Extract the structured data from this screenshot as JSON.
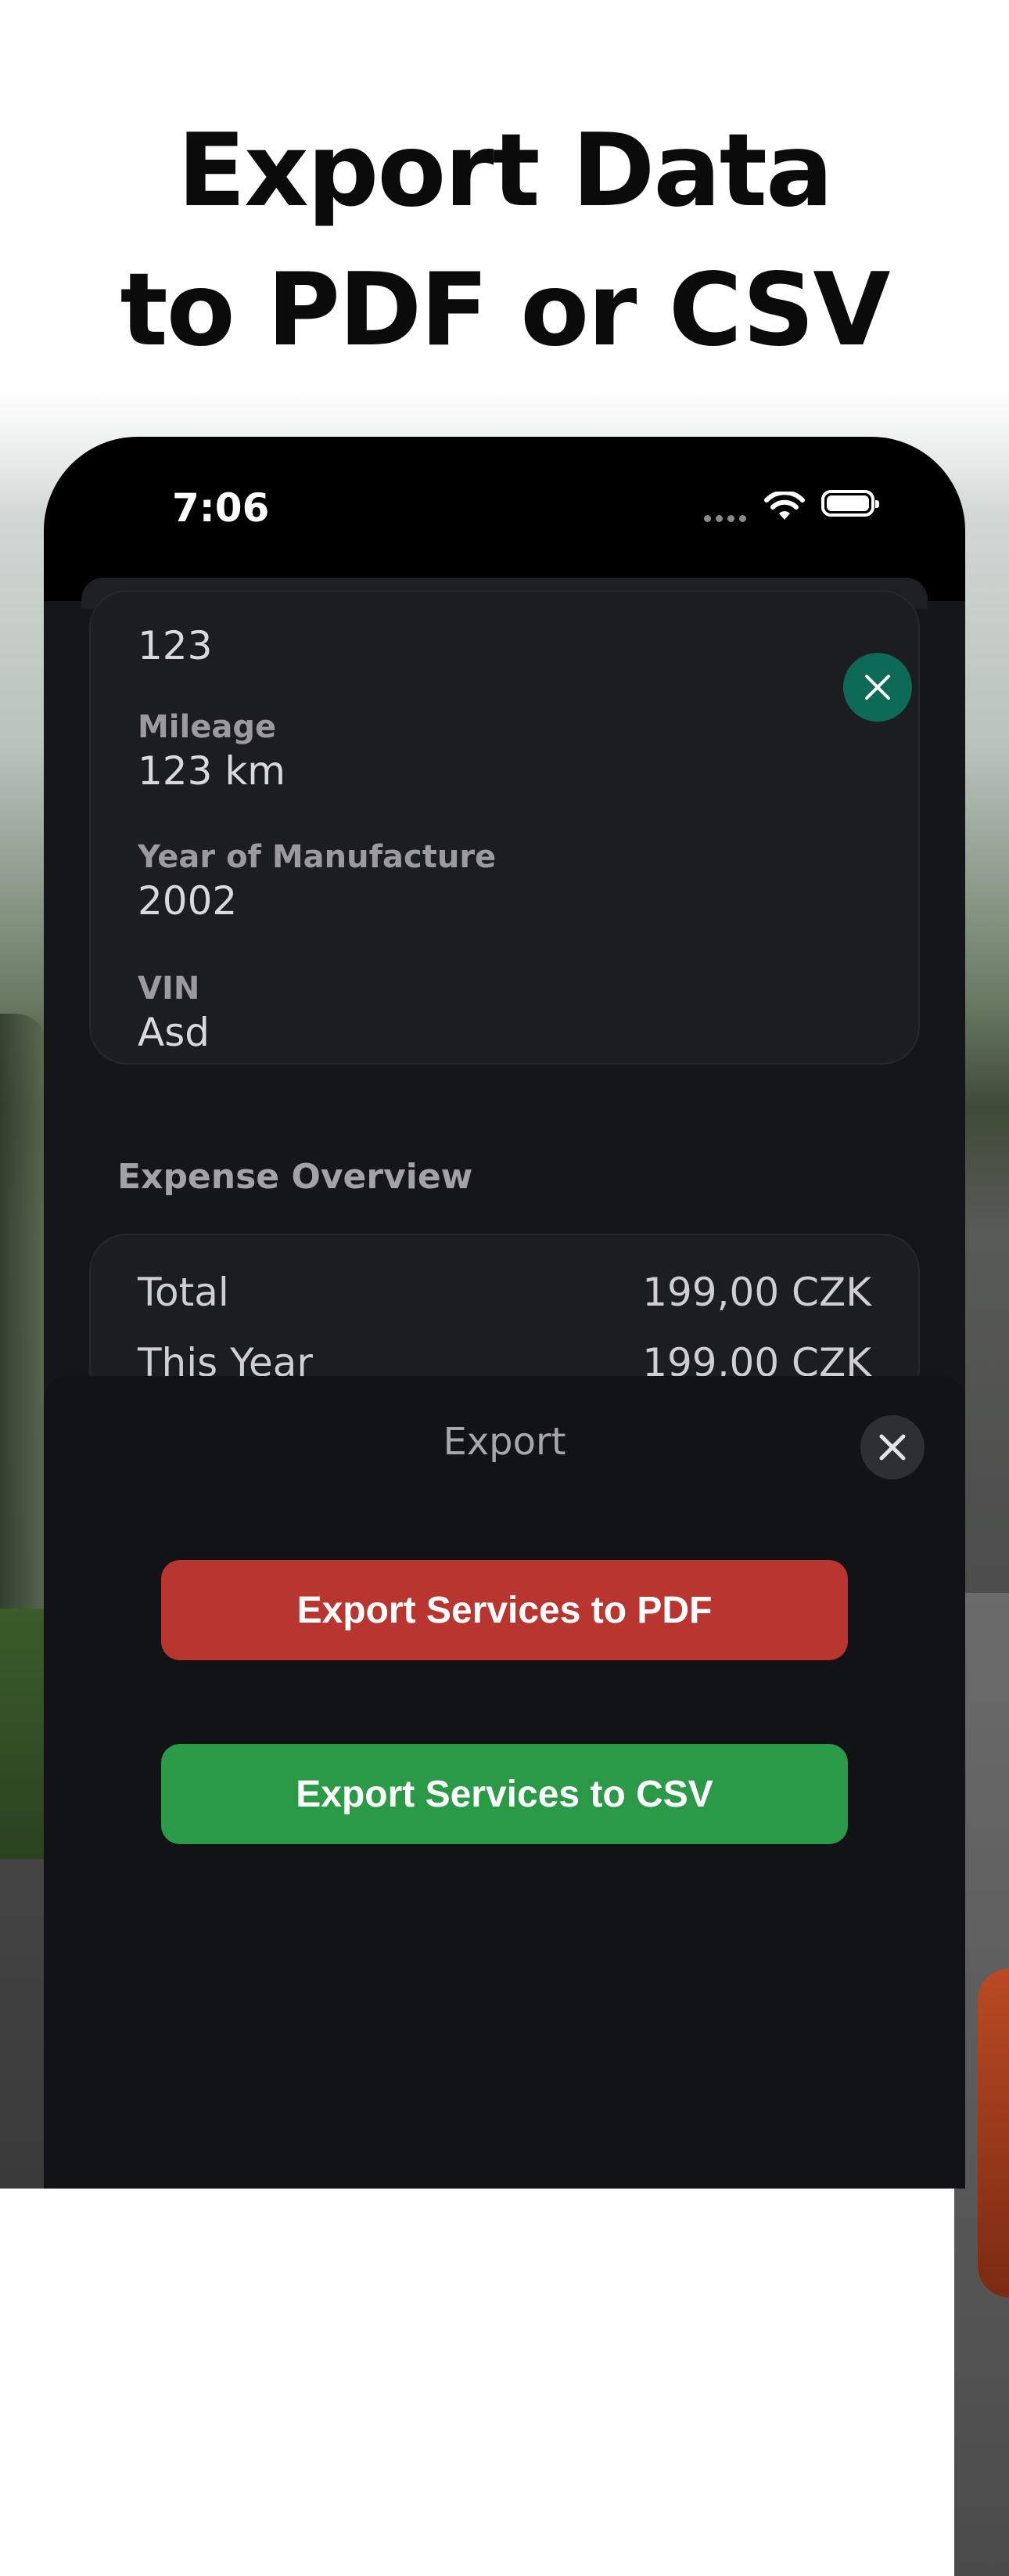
{
  "headline": {
    "line1": "Export Data",
    "line2": "to PDF or CSV"
  },
  "status_bar": {
    "time": "7:06",
    "icons": [
      "cellular-dots-icon",
      "wifi-icon",
      "battery-icon"
    ]
  },
  "vehicle_details": {
    "top_value": "123",
    "fields": [
      {
        "label": "Mileage",
        "value": "123 km"
      },
      {
        "label": "Year of Manufacture",
        "value": "2002"
      },
      {
        "label": "VIN",
        "value": "Asd"
      }
    ],
    "close_icon": "close-icon"
  },
  "expense_overview": {
    "title": "Expense Overview",
    "rows": [
      {
        "label": "Total",
        "value": "199,00 CZK"
      },
      {
        "label": "This Year",
        "value": "199,00 CZK"
      }
    ]
  },
  "export_sheet": {
    "title": "Export",
    "close_icon": "close-icon",
    "pdf_button": "Export Services to PDF",
    "csv_button": "Export Services to CSV"
  },
  "colors": {
    "pdf_button": "#b83530",
    "csv_button": "#2a9a47",
    "accent_close": "#0c6a57",
    "sheet_bg": "#121316"
  }
}
